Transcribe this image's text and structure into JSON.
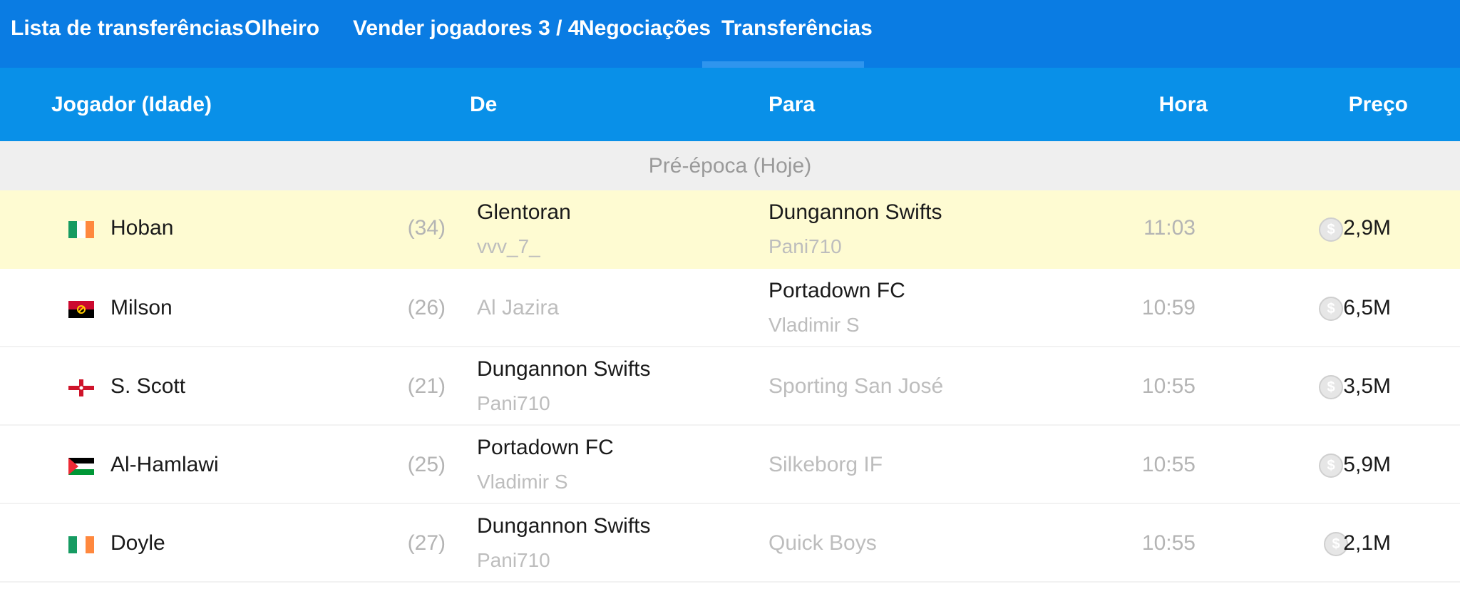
{
  "tabs": [
    {
      "label": "Lista de transferências",
      "active": false
    },
    {
      "label": "Olheiro",
      "active": false
    },
    {
      "label": "Vender jogadores 3 / 4",
      "active": false
    },
    {
      "label": "Negociações",
      "active": false
    },
    {
      "label": "Transferências",
      "active": true
    }
  ],
  "table": {
    "headers": {
      "player": "Jogador (Idade)",
      "from": "De",
      "to": "Para",
      "time": "Hora",
      "price": "Preço"
    },
    "section_label": "Pré-época (Hoje)",
    "rows": [
      {
        "flag": "ireland-flag-icon",
        "name": "Hoban",
        "age": "(34)",
        "from_team": "Glentoran",
        "from_manager": "vvv_7_",
        "to_team": "Dungannon Swifts",
        "to_manager": "Pani710",
        "time": "11:03",
        "price": "2,9M",
        "highlighted": true
      },
      {
        "flag": "angola-flag-icon",
        "name": "Milson",
        "age": "(26)",
        "from_team": "Al Jazira",
        "from_manager": "",
        "to_team": "Portadown FC",
        "to_manager": "Vladimir S",
        "time": "10:59",
        "price": "6,5M",
        "highlighted": false
      },
      {
        "flag": "northern-ireland-flag-icon",
        "name": "S. Scott",
        "age": "(21)",
        "from_team": "Dungannon Swifts",
        "from_manager": "Pani710",
        "to_team": "Sporting San José",
        "to_manager": "",
        "time": "10:55",
        "price": "3,5M",
        "highlighted": false
      },
      {
        "flag": "palestine-flag-icon",
        "name": "Al-Hamlawi",
        "age": "(25)",
        "from_team": "Portadown FC",
        "from_manager": "Vladimir S",
        "to_team": "Silkeborg IF",
        "to_manager": "",
        "time": "10:55",
        "price": "5,9M",
        "highlighted": false
      },
      {
        "flag": "ireland-flag-icon",
        "name": "Doyle",
        "age": "(27)",
        "from_team": "Dungannon Swifts",
        "from_manager": "Pani710",
        "to_team": "Quick Boys",
        "to_manager": "",
        "time": "10:55",
        "price": "2,1M",
        "highlighted": false
      }
    ]
  },
  "coin_icon": "coin-icon",
  "colors": {
    "tab_bar": "#0a7ce3",
    "header": "#0990e8",
    "highlight_row": "#fefbd2"
  }
}
